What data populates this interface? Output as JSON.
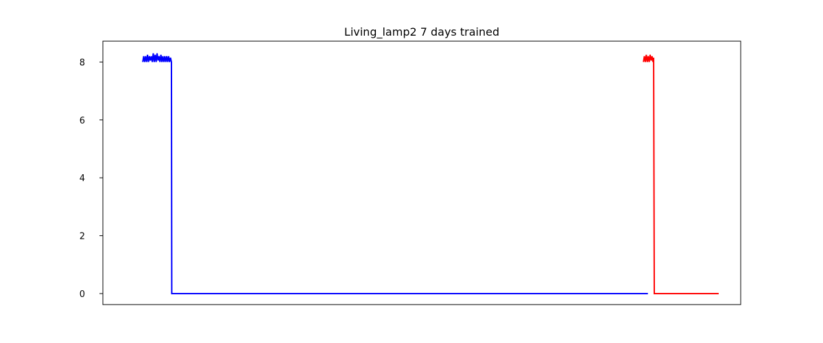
{
  "chart_data": {
    "type": "line",
    "title": "Living_lamp2 7 days trained",
    "xlabel": "",
    "ylabel": "",
    "x_range": [
      0,
      100
    ],
    "xlim": [
      -6.25,
      93.75
    ],
    "ylim": [
      -0.38,
      8.72
    ],
    "yticks": [
      0,
      2,
      4,
      6,
      8
    ],
    "x_ticks_visible": false,
    "grid": false,
    "legend": "none",
    "series": [
      {
        "color": "#0000ff",
        "points": [
          [
            0,
            8.0
          ],
          [
            0.15,
            8.2
          ],
          [
            0.3,
            8.0
          ],
          [
            0.45,
            8.2
          ],
          [
            0.6,
            8.0
          ],
          [
            0.75,
            8.25
          ],
          [
            0.9,
            8.0
          ],
          [
            1.05,
            8.2
          ],
          [
            1.2,
            8.05
          ],
          [
            1.35,
            8.2
          ],
          [
            1.5,
            8.0
          ],
          [
            1.65,
            8.3
          ],
          [
            1.8,
            8.0
          ],
          [
            1.95,
            8.25
          ],
          [
            2.1,
            8.0
          ],
          [
            2.25,
            8.3
          ],
          [
            2.4,
            8.05
          ],
          [
            2.55,
            8.2
          ],
          [
            2.7,
            8.0
          ],
          [
            2.85,
            8.25
          ],
          [
            3.0,
            8.0
          ],
          [
            3.15,
            8.2
          ],
          [
            3.3,
            8.0
          ],
          [
            3.45,
            8.2
          ],
          [
            3.6,
            8.0
          ],
          [
            3.75,
            8.2
          ],
          [
            3.9,
            8.0
          ],
          [
            4.05,
            8.2
          ],
          [
            4.2,
            8.0
          ],
          [
            4.35,
            8.15
          ],
          [
            4.5,
            8.0
          ],
          [
            4.55,
            0.0
          ],
          [
            10,
            0.0
          ],
          [
            20,
            0.0
          ],
          [
            30,
            0.0
          ],
          [
            40,
            0.0
          ],
          [
            50,
            0.0
          ],
          [
            60,
            0.0
          ],
          [
            70,
            0.0
          ],
          [
            79.2,
            0.0
          ]
        ]
      },
      {
        "color": "#ff0000",
        "points": [
          [
            78.5,
            8.0
          ],
          [
            78.65,
            8.2
          ],
          [
            78.8,
            8.0
          ],
          [
            78.95,
            8.25
          ],
          [
            79.1,
            8.0
          ],
          [
            79.25,
            8.2
          ],
          [
            79.4,
            8.0
          ],
          [
            79.55,
            8.25
          ],
          [
            79.7,
            8.05
          ],
          [
            79.85,
            8.2
          ],
          [
            80.0,
            8.0
          ],
          [
            80.1,
            8.15
          ],
          [
            80.2,
            0.0
          ],
          [
            85,
            0.0
          ],
          [
            90,
            0.0
          ],
          [
            90.3,
            0.0
          ]
        ]
      }
    ]
  }
}
